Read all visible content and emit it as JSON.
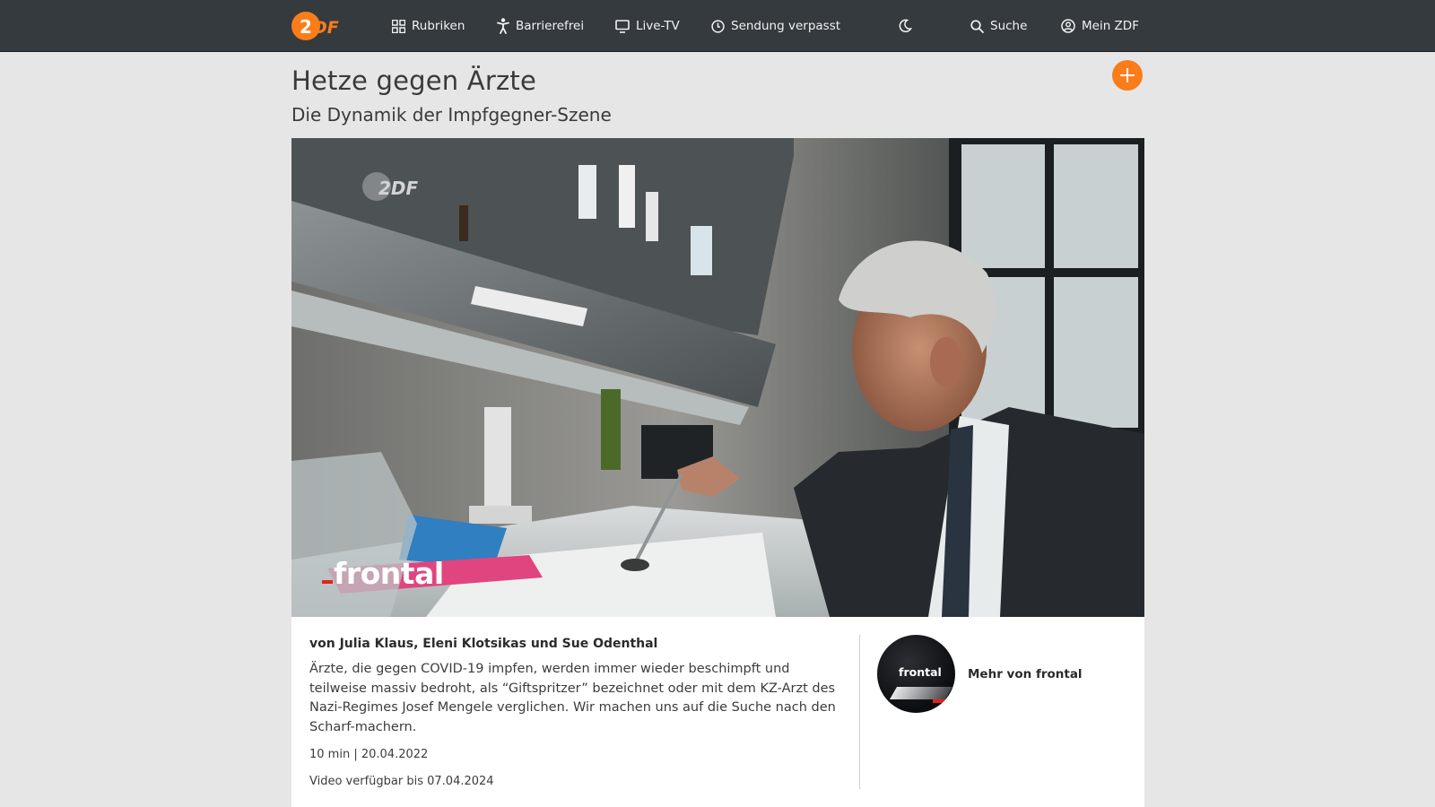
{
  "header": {
    "logo_text": "ZDF",
    "nav": [
      {
        "label": "Rubriken",
        "icon": "grid-icon"
      },
      {
        "label": "Barrierefrei",
        "icon": "accessibility-icon"
      },
      {
        "label": "Live-TV",
        "icon": "tv-icon"
      },
      {
        "label": "Sendung verpasst",
        "icon": "clock-icon"
      }
    ],
    "theme_toggle_icon": "moon-icon",
    "search_label": "Suche",
    "account_label": "Mein ZDF"
  },
  "article": {
    "title": "Hetze gegen Ärzte",
    "subtitle": "Die Dynamik der Impfgegner-Szene",
    "add_icon": "plus-icon"
  },
  "video": {
    "channel_watermark": "ZDF",
    "show_watermark": "frontal"
  },
  "info": {
    "authors": "von Julia Klaus, Eleni Klotsikas und Sue Odenthal",
    "teaser": "Ärzte, die gegen COVID-19 impfen, werden immer wieder beschimpft und teilweise massiv bedroht, als “Giftspritzer” bezeichnet oder mit dem KZ-Arzt des Nazi-Regimes Josef Mengele verglichen. Wir machen uns auf die Suche nach den Scharf-machern.",
    "duration": "10 min",
    "date": "20.04.2022",
    "availability": "Video verfügbar bis 07.04.2024",
    "brand_avatar_text": "frontal",
    "brand_link": "Mehr von frontal"
  },
  "colors": {
    "header_bg": "#353a3f",
    "accent": "#fa7d19",
    "page_bg": "#e6e6e6",
    "card_bg": "#ffffff",
    "frontal_red": "#e2231a"
  }
}
